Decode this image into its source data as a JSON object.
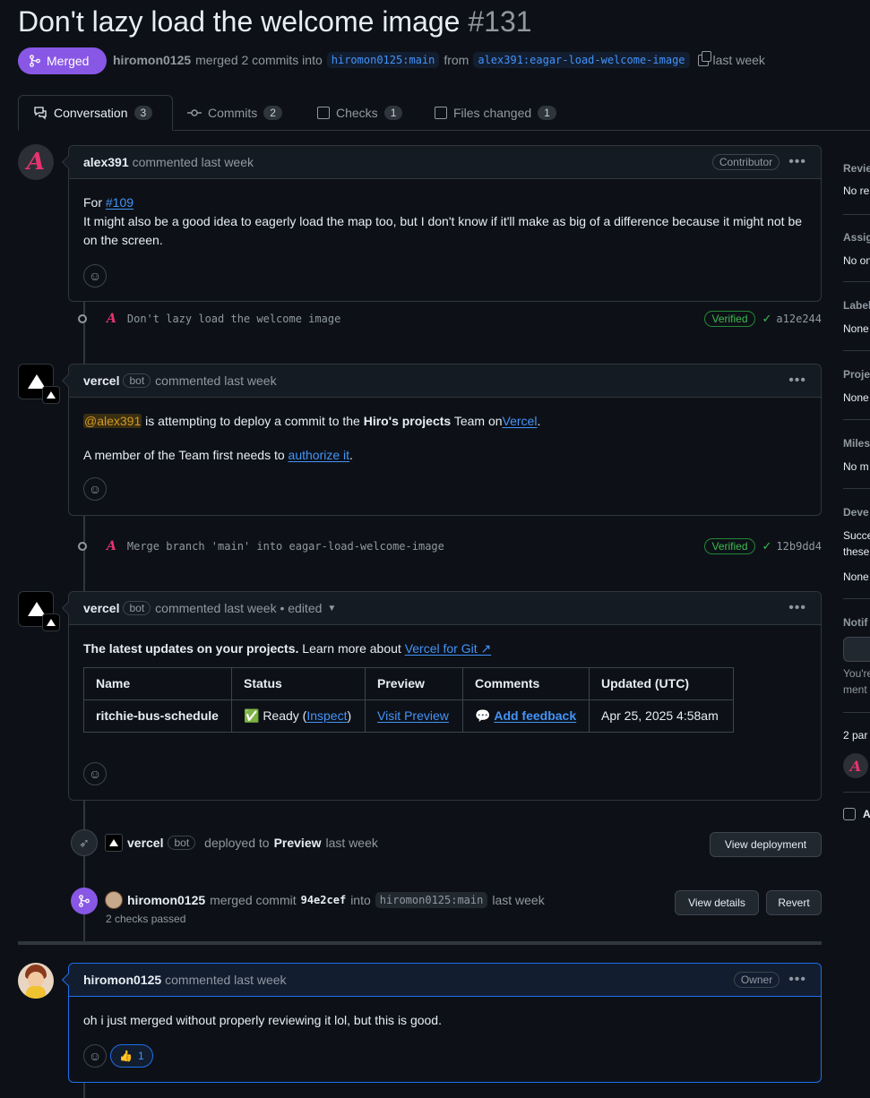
{
  "pr": {
    "title": "Don't lazy load the welcome image",
    "number": "#131",
    "state": "Merged",
    "author": "hiromon0125",
    "merged_text": "merged 2 commits into",
    "base_branch": "hiromon0125:main",
    "from_text": "from",
    "head_branch": "alex391:eagar-load-welcome-image",
    "time": "last week"
  },
  "tabs": [
    {
      "label": "Conversation",
      "count": "3",
      "icon": "conversation-icon"
    },
    {
      "label": "Commits",
      "count": "2",
      "icon": "commit-icon"
    },
    {
      "label": "Checks",
      "count": "1",
      "icon": "checklist-icon"
    },
    {
      "label": "Files changed",
      "count": "1",
      "icon": "file-diff-icon"
    }
  ],
  "comment1": {
    "author": "alex391",
    "meta": "commented last week",
    "role": "Contributor",
    "for_label": "For",
    "issue_link": "#109",
    "text": "It might also be a good idea to eagerly load the map too, but I don't know if it'll make as big of a difference because it might not be on the screen."
  },
  "commit1": {
    "message": "Don't lazy load the welcome image",
    "verified": "Verified",
    "sha": "a12e244"
  },
  "comment2": {
    "author": "vercel",
    "bot": "bot",
    "meta": "commented last week",
    "mention": "@alex391",
    "text1": "is attempting to deploy a commit to the",
    "team": "Hiro's projects",
    "text2": "Team on",
    "vercel_link": "Vercel",
    "text3": "A member of the Team first needs to",
    "authorize_link": "authorize it"
  },
  "commit2": {
    "message": "Merge branch 'main' into eagar-load-welcome-image",
    "verified": "Verified",
    "sha": "12b9dd4"
  },
  "comment3": {
    "author": "vercel",
    "bot": "bot",
    "meta": "commented last week • edited",
    "lead_bold": "The latest updates on your projects.",
    "lead_text": "Learn more about",
    "lead_link": "Vercel for Git ↗",
    "table": {
      "headers": [
        "Name",
        "Status",
        "Preview",
        "Comments",
        "Updated (UTC)"
      ],
      "row": {
        "name": "ritchie-bus-schedule",
        "status_prefix": "✅ Ready (",
        "status_link": "Inspect",
        "status_suffix": ")",
        "preview": "Visit Preview",
        "comments_icon": "💬",
        "comments": "Add feedback",
        "updated": "Apr 25, 2025 4:58am"
      }
    }
  },
  "deploy_event": {
    "actor": "vercel",
    "bot": "bot",
    "text": "deployed to",
    "env": "Preview",
    "time": "last week",
    "button": "View deployment"
  },
  "merge_event": {
    "actor": "hiromon0125",
    "text": "merged commit",
    "sha": "94e2cef",
    "into": "into",
    "branch": "hiromon0125:main",
    "time": "last week",
    "checks": "2 checks passed",
    "btn_details": "View details",
    "btn_revert": "Revert"
  },
  "comment4": {
    "author": "hiromon0125",
    "meta": "commented last week",
    "role": "Owner",
    "text": "oh i just merged without properly reviewing it lol, but this is good.",
    "reaction_emoji": "👍",
    "reaction_count": "1"
  },
  "sidebar": {
    "reviewers_label": "Revie",
    "reviewers_val": "No re",
    "assignees_label": "Assig",
    "assignees_val": "No on",
    "labels_label": "Label",
    "labels_val": "None",
    "projects_label": "Proje",
    "projects_val": "None",
    "milestone_label": "Miles",
    "milestone_val": "No m",
    "dev_label": "Deve",
    "dev_val1": "Succe",
    "dev_val2": "these",
    "dev_val3": "None",
    "notif_label": "Notif",
    "notif_text1": "You're",
    "notif_text2": "ment",
    "participants_label": "2 par",
    "lock_label": "A"
  },
  "colors": {
    "merged": "#8957e5",
    "link": "#4493f8",
    "verified": "#3fb950",
    "bg": "#0d1117"
  }
}
